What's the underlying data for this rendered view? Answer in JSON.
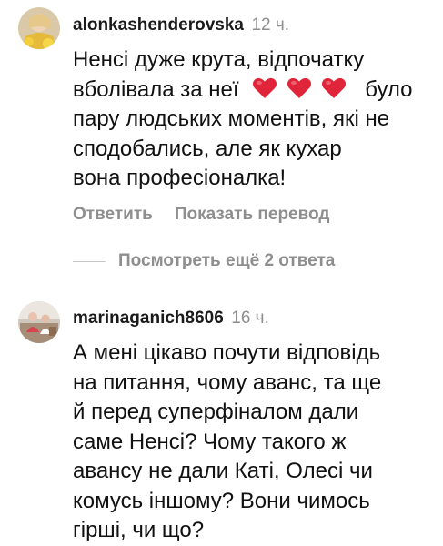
{
  "comments": [
    {
      "username": "alonkashenderovska",
      "time": "12 ч.",
      "text_lines": [
        "Ненсі дуже крута, відпочатку",
        "вболівала за неї",
        "було",
        "пару людських моментів, які не",
        "сподобались, але як кухар",
        "вона професіоналка!"
      ],
      "hearts_icon": "red-heart-emoji",
      "hearts_count": 3,
      "reply_label": "Ответить",
      "translate_label": "Показать перевод",
      "view_replies_label": "Посмотреть ещё 2 ответа"
    },
    {
      "username": "marinaganich8606",
      "time": "16 ч.",
      "text_lines": [
        "А мені цікаво почути відповідь",
        "на питання, чому аванс, та ще",
        "й перед суперфіналом дали",
        "саме Ненсі? Чому такого ж",
        "авансу не дали Каті, Олесі чи",
        "комусь іншому? Вони чимось",
        "гірші, чи що?"
      ]
    }
  ],
  "colors": {
    "text": "#111111",
    "secondary": "#8e8e8e",
    "heart": "#e0253a"
  }
}
